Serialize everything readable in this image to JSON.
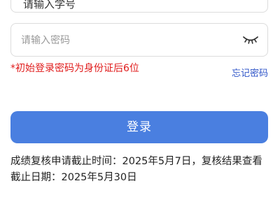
{
  "account": {
    "value": "请输入学号"
  },
  "password": {
    "placeholder": "请输入密码",
    "toggle_icon": "eye-closed-icon"
  },
  "hint": "*初始登录密码为身份证后6位",
  "forgot_link": "忘记密码",
  "login_button": "登录",
  "notice": "成绩复核申请截止时间：2025年5月7日，复核结果查看截止日期：2025年5月30日",
  "colors": {
    "primary_button": "#4a7fe0",
    "hint_text": "#e01c1c",
    "link_text": "#2f55c8"
  }
}
